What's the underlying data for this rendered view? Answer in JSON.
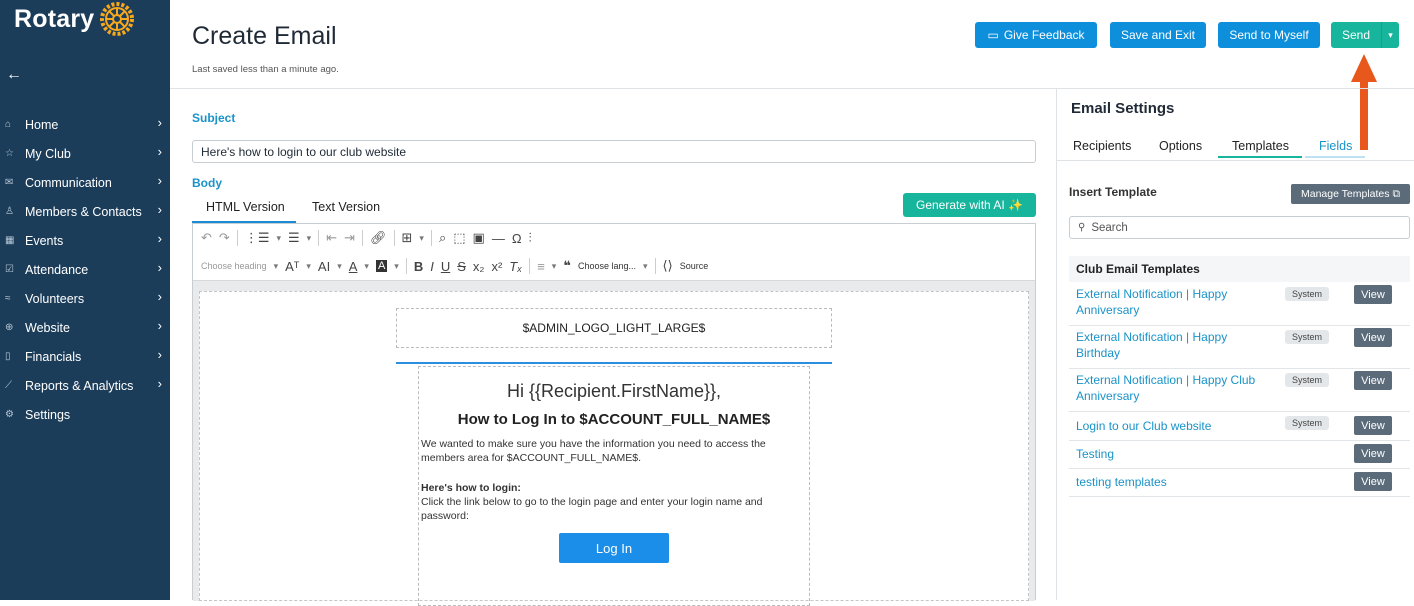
{
  "sidebar": {
    "brand": "Rotary",
    "items": [
      {
        "label": "Home",
        "icon": "house-icon"
      },
      {
        "label": "My Club",
        "icon": "star-icon"
      },
      {
        "label": "Communication",
        "icon": "envelope-icon"
      },
      {
        "label": "Members & Contacts",
        "icon": "person-icon"
      },
      {
        "label": "Events",
        "icon": "calendar-icon"
      },
      {
        "label": "Attendance",
        "icon": "checkbox-icon"
      },
      {
        "label": "Volunteers",
        "icon": "handshake-icon"
      },
      {
        "label": "Website",
        "icon": "globe-icon"
      },
      {
        "label": "Financials",
        "icon": "document-icon"
      },
      {
        "label": "Reports & Analytics",
        "icon": "chart-icon"
      },
      {
        "label": "Settings",
        "icon": "gear-icon"
      }
    ]
  },
  "header": {
    "title": "Create Email",
    "saved": "Last saved less than a minute ago.",
    "feedback_label": "Give Feedback",
    "save_exit_label": "Save and Exit",
    "send_myself_label": "Send to Myself",
    "send_label": "Send"
  },
  "form": {
    "subject_label": "Subject",
    "subject_value": "Here's how to login to our club website",
    "body_label": "Body",
    "tab_html": "HTML Version",
    "tab_text": "Text Version",
    "ai_label": "Generate with AI ✨"
  },
  "toolbar": {
    "heading_placeholder": "Choose heading",
    "language_placeholder": "Choose lang...",
    "source_label": "Source"
  },
  "email": {
    "logo_placeholder": "$ADMIN_LOGO_LIGHT_LARGE$",
    "greeting": "Hi {{Recipient.FirstName}},",
    "heading": "How to Log In to $ACCOUNT_FULL_NAME$",
    "para1": "We wanted to make sure you have the information you need to access the members area for $ACCOUNT_FULL_NAME$.",
    "para2_bold": "Here's how to login:",
    "para2": "Click the link below to go to the login page and enter your login name and password:",
    "button_label": "Log In"
  },
  "settings": {
    "title": "Email Settings",
    "tabs": [
      "Recipients",
      "Options",
      "Templates",
      "Fields"
    ],
    "insert_label": "Insert Template",
    "manage_label": "Manage Templates",
    "search_placeholder": "Search",
    "table_header": "Club Email Templates",
    "badge_label": "System",
    "view_label": "View",
    "templates": [
      "External Notification | Happy Anniversary",
      "External Notification | Happy Birthday",
      "External Notification | Happy Club Anniversary",
      "Login to our Club website",
      "Testing",
      "testing templates"
    ]
  },
  "colors": {
    "sidebar": "#1c3d5a",
    "accent_blue": "#0d8fdc",
    "accent_green": "#16b59c",
    "arrow": "#e8571c"
  }
}
